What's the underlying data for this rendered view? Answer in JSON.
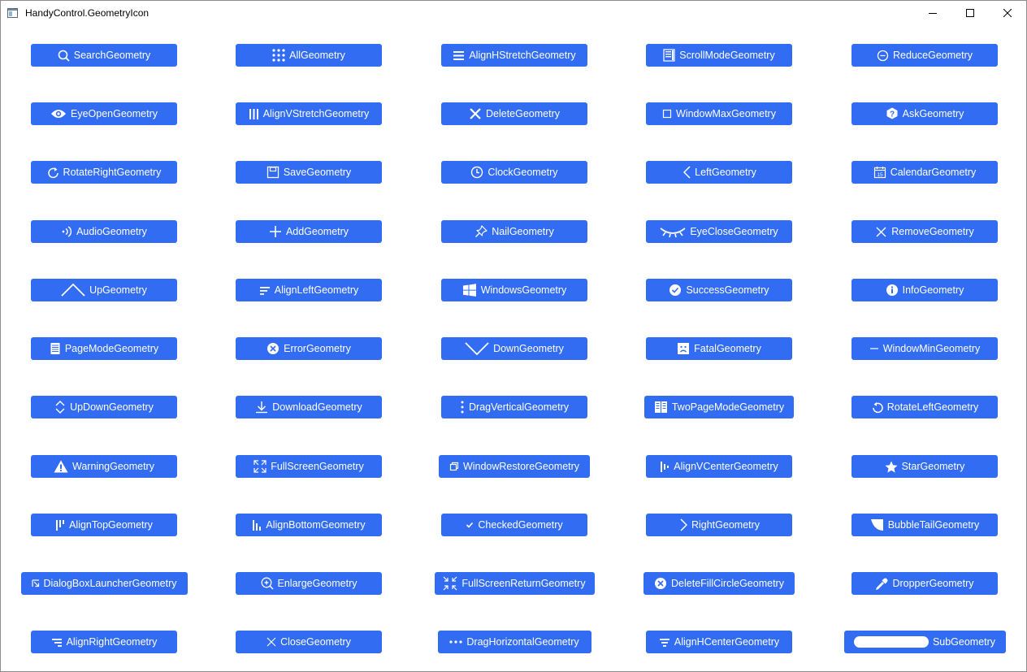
{
  "window": {
    "title": "HandyControl.GeometryIcon",
    "controls": {
      "minimize": "minimize-icon",
      "maximize": "maximize-icon",
      "close": "close-icon"
    }
  },
  "colors": {
    "button_bg": "#326cf3",
    "button_text": "#ffffff",
    "window_bg": "#ffffff"
  },
  "buttons": [
    {
      "label": "SearchGeometry",
      "icon": "search"
    },
    {
      "label": "AllGeometry",
      "icon": "all"
    },
    {
      "label": "AlignHStretchGeometry",
      "icon": "align-h-stretch"
    },
    {
      "label": "ScrollModeGeometry",
      "icon": "scroll-mode"
    },
    {
      "label": "ReduceGeometry",
      "icon": "reduce"
    },
    {
      "label": "EyeOpenGeometry",
      "icon": "eye-open"
    },
    {
      "label": "AlignVStretchGeometry",
      "icon": "align-v-stretch"
    },
    {
      "label": "DeleteGeometry",
      "icon": "delete"
    },
    {
      "label": "WindowMaxGeometry",
      "icon": "window-max"
    },
    {
      "label": "AskGeometry",
      "icon": "ask"
    },
    {
      "label": "RotateRightGeometry",
      "icon": "rotate-right"
    },
    {
      "label": "SaveGeometry",
      "icon": "save"
    },
    {
      "label": "ClockGeometry",
      "icon": "clock"
    },
    {
      "label": "LeftGeometry",
      "icon": "left"
    },
    {
      "label": "CalendarGeometry",
      "icon": "calendar"
    },
    {
      "label": "AudioGeometry",
      "icon": "audio"
    },
    {
      "label": "AddGeometry",
      "icon": "add"
    },
    {
      "label": "NailGeometry",
      "icon": "nail"
    },
    {
      "label": "EyeCloseGeometry",
      "icon": "eye-close"
    },
    {
      "label": "RemoveGeometry",
      "icon": "remove"
    },
    {
      "label": "UpGeometry",
      "icon": "up"
    },
    {
      "label": "AlignLeftGeometry",
      "icon": "align-left"
    },
    {
      "label": "WindowsGeometry",
      "icon": "windows"
    },
    {
      "label": "SuccessGeometry",
      "icon": "success"
    },
    {
      "label": "InfoGeometry",
      "icon": "info"
    },
    {
      "label": "PageModeGeometry",
      "icon": "page-mode"
    },
    {
      "label": "ErrorGeometry",
      "icon": "error"
    },
    {
      "label": "DownGeometry",
      "icon": "down"
    },
    {
      "label": "FatalGeometry",
      "icon": "fatal"
    },
    {
      "label": "WindowMinGeometry",
      "icon": "window-min"
    },
    {
      "label": "UpDownGeometry",
      "icon": "up-down"
    },
    {
      "label": "DownloadGeometry",
      "icon": "download"
    },
    {
      "label": "DragVerticalGeometry",
      "icon": "drag-vertical"
    },
    {
      "label": "TwoPageModeGeometry",
      "icon": "two-page-mode"
    },
    {
      "label": "RotateLeftGeometry",
      "icon": "rotate-left"
    },
    {
      "label": "WarningGeometry",
      "icon": "warning"
    },
    {
      "label": "FullScreenGeometry",
      "icon": "full-screen"
    },
    {
      "label": "WindowRestoreGeometry",
      "icon": "window-restore"
    },
    {
      "label": "AlignVCenterGeometry",
      "icon": "align-v-center"
    },
    {
      "label": "StarGeometry",
      "icon": "star"
    },
    {
      "label": "AlignTopGeometry",
      "icon": "align-top"
    },
    {
      "label": "AlignBottomGeometry",
      "icon": "align-bottom"
    },
    {
      "label": "CheckedGeometry",
      "icon": "checked"
    },
    {
      "label": "RightGeometry",
      "icon": "right"
    },
    {
      "label": "BubbleTailGeometry",
      "icon": "bubble-tail"
    },
    {
      "label": "DialogBoxLauncherGeometry",
      "icon": "dialog-box-launcher"
    },
    {
      "label": "EnlargeGeometry",
      "icon": "enlarge"
    },
    {
      "label": "FullScreenReturnGeometry",
      "icon": "full-screen-return"
    },
    {
      "label": "DeleteFillCircleGeometry",
      "icon": "delete-fill-circle"
    },
    {
      "label": "DropperGeometry",
      "icon": "dropper"
    },
    {
      "label": "AlignRightGeometry",
      "icon": "align-right"
    },
    {
      "label": "CloseGeometry",
      "icon": "close"
    },
    {
      "label": "DragHorizontalGeometry",
      "icon": "drag-horizontal"
    },
    {
      "label": "AlignHCenterGeometry",
      "icon": "align-h-center"
    },
    {
      "label": "SubGeometry",
      "icon": "sub"
    }
  ]
}
